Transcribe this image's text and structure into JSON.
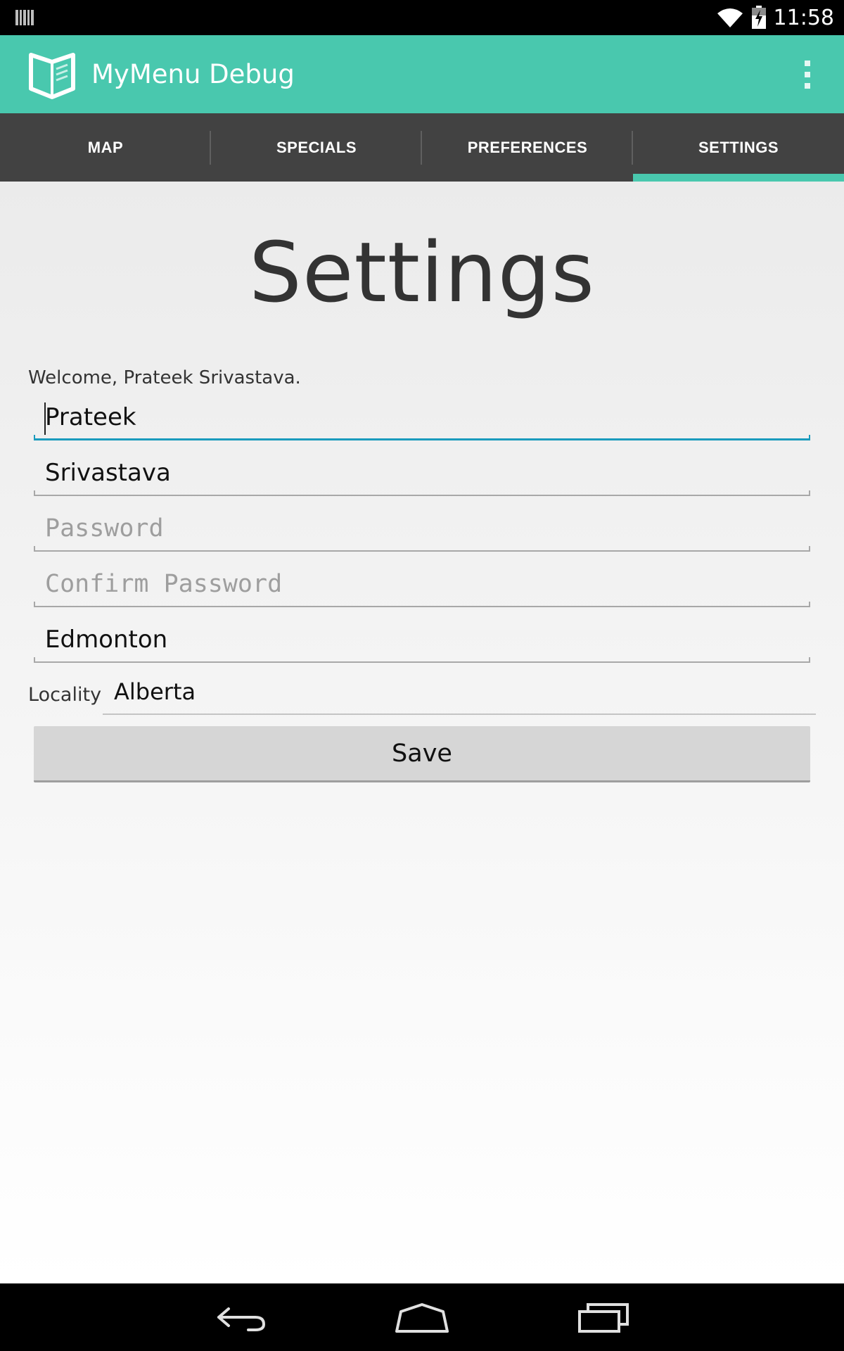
{
  "status_bar": {
    "time": "11:58"
  },
  "app_bar": {
    "title": "MyMenu Debug"
  },
  "tabs": [
    {
      "label": "MAP"
    },
    {
      "label": "SPECIALS"
    },
    {
      "label": "PREFERENCES"
    },
    {
      "label": "SETTINGS"
    }
  ],
  "active_tab": "SETTINGS",
  "page": {
    "heading": "Settings",
    "welcome": "Welcome, Prateek Srivastava."
  },
  "form": {
    "first_name": {
      "value": "Prateek"
    },
    "last_name": {
      "value": "Srivastava"
    },
    "password": {
      "value": "",
      "placeholder": "Password"
    },
    "confirm_password": {
      "value": "",
      "placeholder": "Confirm Password"
    },
    "city": {
      "value": "Edmonton"
    },
    "locality": {
      "label": "Locality",
      "value": "Alberta"
    },
    "save_label": "Save"
  },
  "colors": {
    "accent": "#49c8ae",
    "tab_bar": "#424242",
    "focus_underline": "#1a9bbd"
  },
  "icons": {
    "notification": "barcode-notification-icon",
    "wifi": "wifi-icon",
    "battery": "battery-charging-icon",
    "logo": "menu-book-logo-icon",
    "overflow": "overflow-menu-icon",
    "back": "back-icon",
    "home": "home-icon",
    "recents": "recent-apps-icon"
  }
}
